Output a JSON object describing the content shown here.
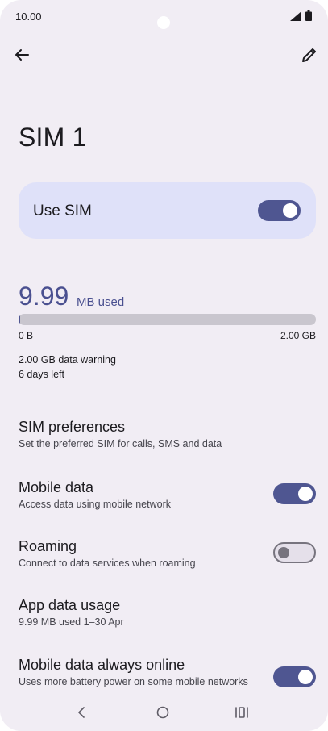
{
  "status_bar": {
    "time": "10.00",
    "icons": [
      "signal-icon",
      "battery-icon"
    ]
  },
  "toolbar": {
    "back_icon": "arrow-left-icon",
    "edit_icon": "pencil-icon"
  },
  "page": {
    "title": "SIM 1"
  },
  "use_sim": {
    "label": "Use SIM",
    "enabled": true
  },
  "usage": {
    "value": "9.99",
    "unit": "MB used",
    "bar_fraction": 0.005,
    "min_label": "0 B",
    "max_label": "2.00 GB",
    "warning": "2.00 GB data warning",
    "days_left": "6 days left"
  },
  "settings": [
    {
      "title": "SIM preferences",
      "subtitle": "Set the preferred SIM for calls, SMS and data"
    },
    {
      "title": "Mobile data",
      "subtitle": "Access data using mobile network",
      "toggle": true
    },
    {
      "title": "Roaming",
      "subtitle": "Connect to data services when roaming",
      "toggle": false
    },
    {
      "title": "App data usage",
      "subtitle": "9.99 MB used 1–30 Apr"
    },
    {
      "title": "Mobile data always online",
      "subtitle": "Uses more battery power on some mobile networks",
      "toggle": true
    }
  ],
  "nav": {
    "back": "back-chevron-icon",
    "home": "home-circle-icon",
    "recents": "recents-icon"
  },
  "colors": {
    "background": "#f1edf4",
    "accent": "#4f5691",
    "card": "#dfe1f9",
    "usage_text": "#4a5090"
  }
}
